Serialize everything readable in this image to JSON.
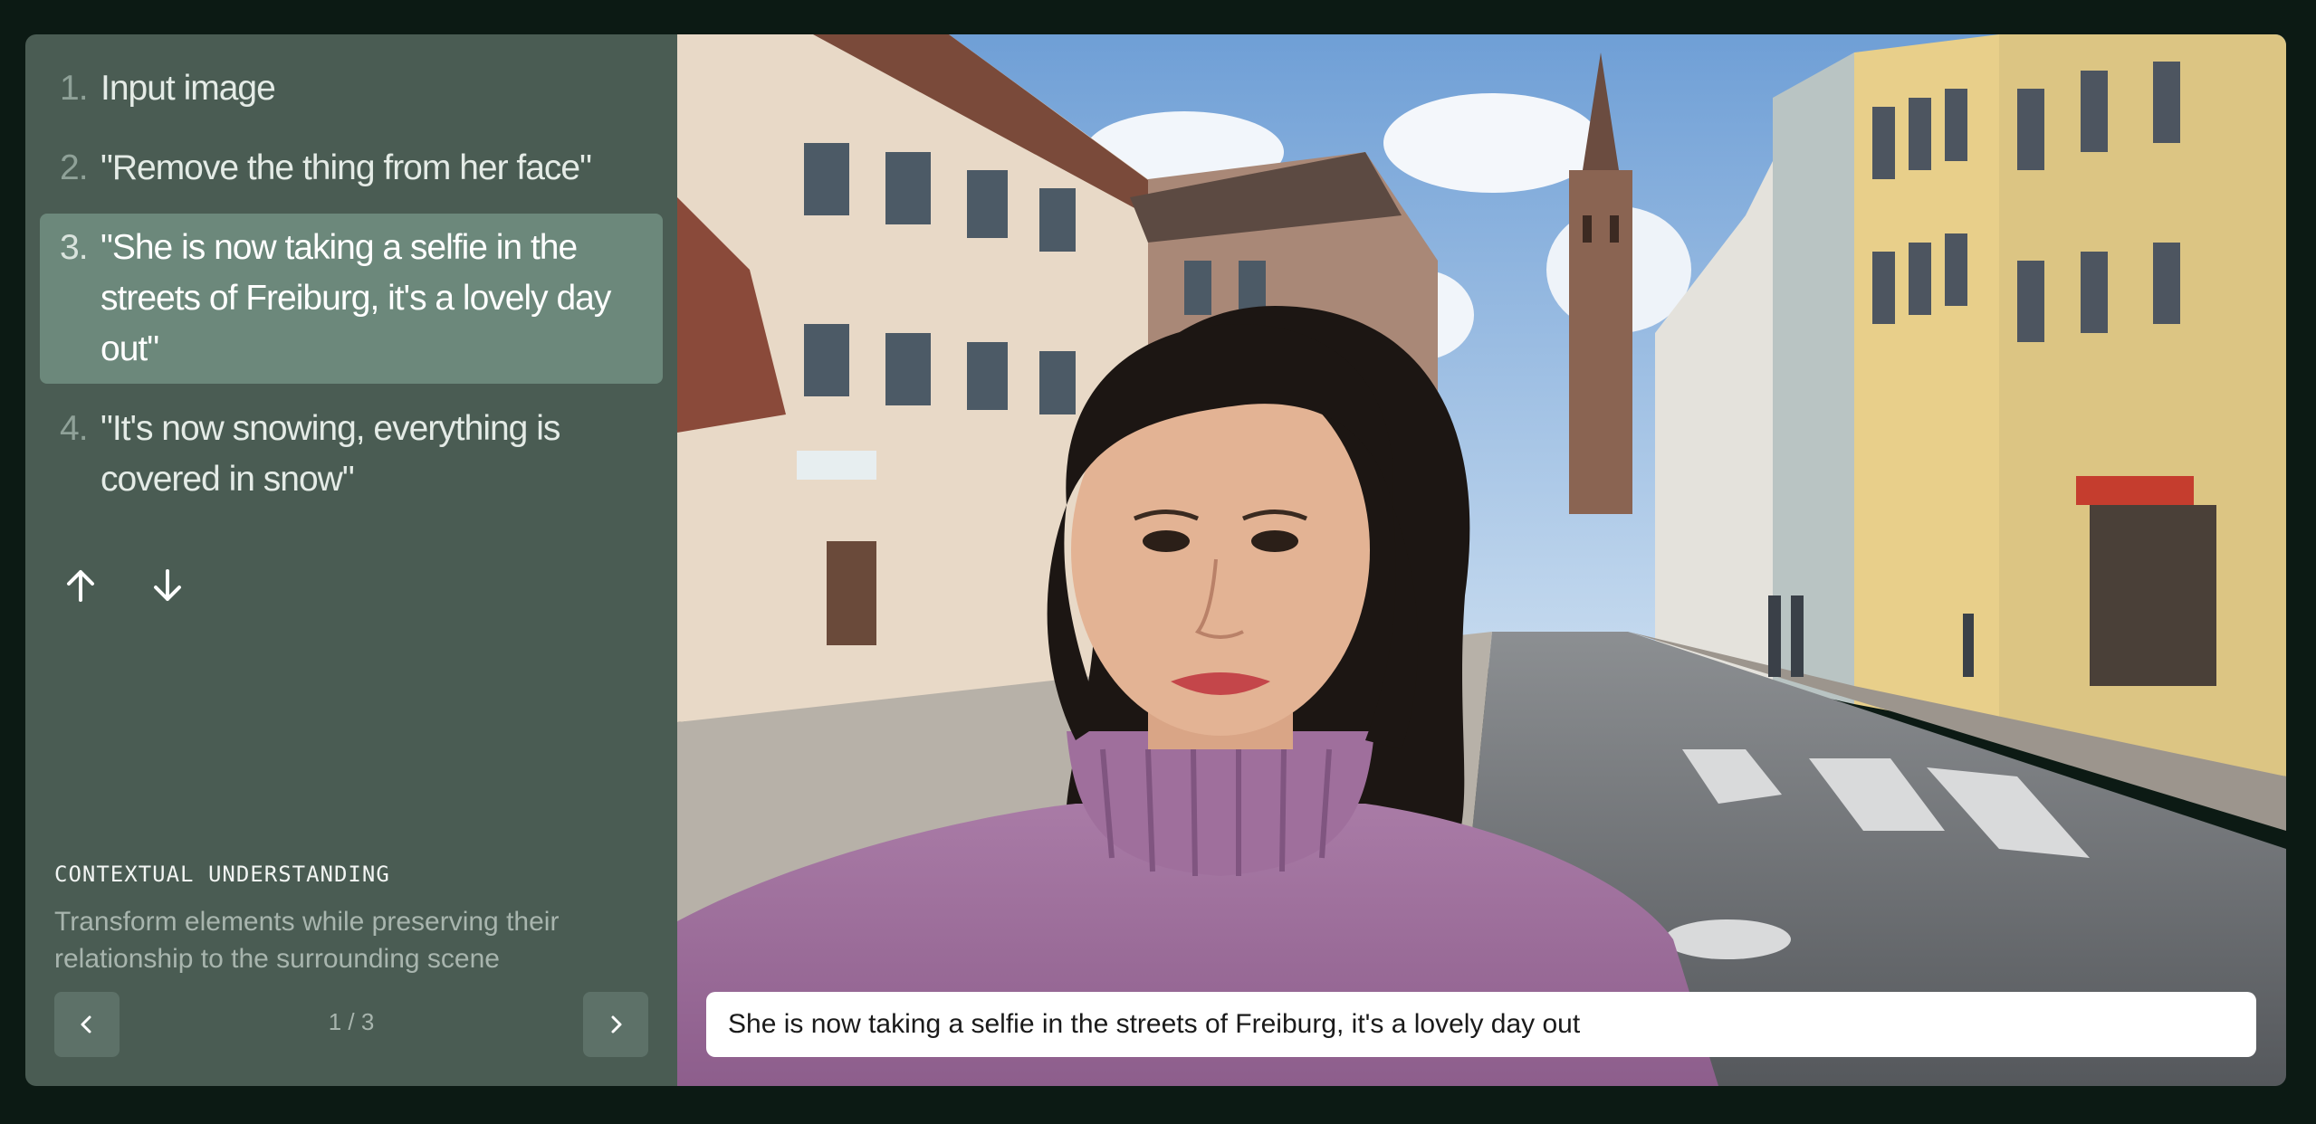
{
  "steps": [
    {
      "num": "1.",
      "text": "Input image"
    },
    {
      "num": "2.",
      "text": "\"Remove the thing from her face\""
    },
    {
      "num": "3.",
      "text": "\"She is now taking a selfie in the streets of Freiburg, it's a lovely day out\""
    },
    {
      "num": "4.",
      "text": "\"It's now snowing, everything is covered in snow\""
    }
  ],
  "active_step": 3,
  "section": {
    "label": "CONTEXTUAL UNDERSTANDING",
    "description": "Transform elements while preserving their relationship to the surrounding scene"
  },
  "pagination": {
    "current": "1 / 3"
  },
  "icons": {
    "up": "arrow-up-icon",
    "down": "arrow-down-icon",
    "prev": "chevron-left-icon",
    "next": "chevron-right-icon"
  },
  "image": {
    "caption": "She is now taking a selfie in the streets of Freiburg, it's a lovely day out"
  },
  "colors": {
    "page_bg": "#0c1a14",
    "sidebar_bg": "#4a5c53",
    "active_step_bg": "#6c887b"
  }
}
